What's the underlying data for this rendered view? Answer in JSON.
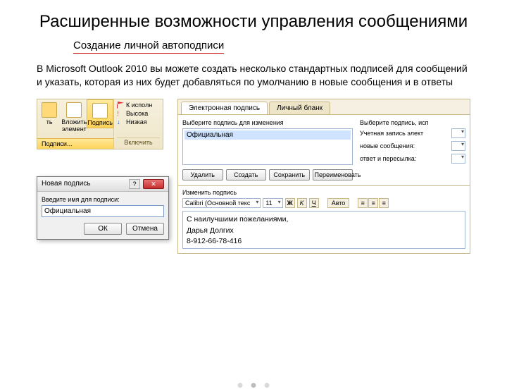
{
  "slide": {
    "title": "Расширенные возможности управления сообщениями",
    "subtitle": "Создание личной автоподписи",
    "body": "В Microsoft Outlook 2010 вы можете создать несколько стандартных подписей для сообщений и указать, которая из них будет добавляться по умолчанию в новые сообщения и в ответы"
  },
  "ribbon": {
    "btn_attach": "ть",
    "btn_insert": "Вложить элемент",
    "btn_sign": "Подпись",
    "dropdown": "Подписи...",
    "priority_high": "К исполн",
    "priority_med": "Высока",
    "priority_low": "Низкая",
    "include": "Включить"
  },
  "dialog": {
    "title": "Новая подпись",
    "label": "Введите имя для подписи:",
    "value": "Официальная",
    "ok": "ОК",
    "cancel": "Отмена"
  },
  "panel": {
    "tab1": "Электронная подпись",
    "tab2": "Личный бланк",
    "select_label": "Выберите подпись для изменения",
    "list_item": "Официальная",
    "btn_delete": "Удалить",
    "btn_new": "Создать",
    "btn_save": "Сохранить",
    "btn_rename": "Переименовать",
    "right_header": "Выберите подпись, исп",
    "account_label": "Учетная запись элект",
    "newmsg_label": "новые сообщения:",
    "reply_label": "ответ и пересылка:",
    "edit_label": "Изменить подпись",
    "font": "Calibri (Основной текс",
    "size": "11",
    "auto": "Авто",
    "sig_line1": "С наилучшими пожеланиями,",
    "sig_line2": "Дарья Долгих",
    "sig_line3": "8-912-66-78-416"
  }
}
